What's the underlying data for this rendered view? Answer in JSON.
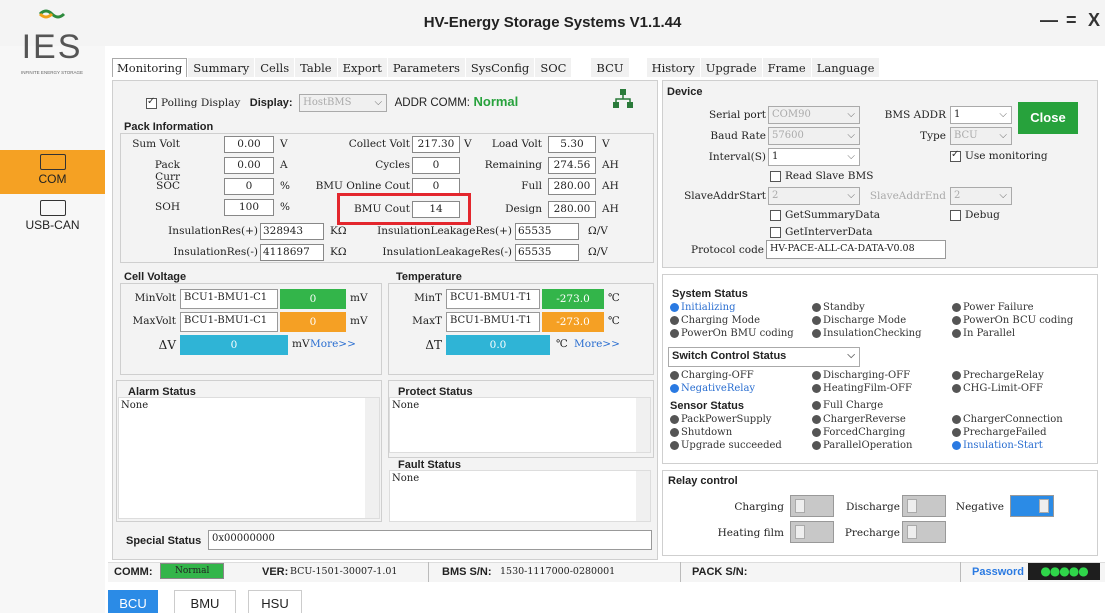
{
  "window": {
    "title": "HV-Energy Storage Systems V1.1.44",
    "min": "—",
    "restore": "=",
    "close": "X"
  },
  "sidebar": {
    "logo_text": "IES",
    "logo_sub": "INFINITE ENERGY STORAGE",
    "items": [
      {
        "label": "COM",
        "active": true
      },
      {
        "label": "USB-CAN",
        "active": false
      }
    ]
  },
  "tabs": [
    "Monitoring",
    "Summary",
    "Cells",
    "Table",
    "Export",
    "Parameters",
    "SysConfig",
    "SOC",
    "BCU",
    "History",
    "Upgrade",
    "Frame",
    "Language"
  ],
  "top": {
    "polling_label": "Polling Display",
    "display_label": "Display:",
    "display_value": "HostBMS",
    "addr_comm_label": "ADDR COMM:",
    "addr_comm_value": "Normal"
  },
  "pack": {
    "header": "Pack Information",
    "sum_volt": {
      "label": "Sum Volt",
      "value": "0.00",
      "unit": "V"
    },
    "pack_curr": {
      "label": "Pack Curr",
      "value": "0.00",
      "unit": "A"
    },
    "soc": {
      "label": "SOC",
      "value": "0",
      "unit": "%"
    },
    "soh": {
      "label": "SOH",
      "value": "100",
      "unit": "%"
    },
    "collect_volt": {
      "label": "Collect Volt",
      "value": "217.30",
      "unit": "V"
    },
    "cycles": {
      "label": "Cycles",
      "value": "0"
    },
    "bmu_online": {
      "label": "BMU Online Cout",
      "value": "0"
    },
    "bmu_cout": {
      "label": "BMU Cout",
      "value": "14"
    },
    "load_volt": {
      "label": "Load Volt",
      "value": "5.30",
      "unit": "V"
    },
    "remaining": {
      "label": "Remaining",
      "value": "274.56",
      "unit": "AH"
    },
    "full": {
      "label": "Full",
      "value": "280.00",
      "unit": "AH"
    },
    "design": {
      "label": "Design",
      "value": "280.00",
      "unit": "AH"
    },
    "ins_pos": {
      "label": "InsulationRes(+)",
      "value": "328943",
      "unit": "KΩ"
    },
    "ins_neg": {
      "label": "InsulationRes(-)",
      "value": "4118697",
      "unit": "KΩ"
    },
    "leak_pos": {
      "label": "InsulationLeakageRes(+)",
      "value": "65535",
      "unit": "Ω/V"
    },
    "leak_neg": {
      "label": "InsulationLeakageRes(-)",
      "value": "65535",
      "unit": "Ω/V"
    }
  },
  "cell_voltage": {
    "header": "Cell Voltage",
    "min_label": "MinVolt",
    "min_id": "BCU1-BMU1-C1",
    "min_val": "0",
    "max_label": "MaxVolt",
    "max_id": "BCU1-BMU1-C1",
    "max_val": "0",
    "unit": "mV",
    "delta_label": "ΔV",
    "delta_val": "0",
    "more": "More>>"
  },
  "temperature": {
    "header": "Temperature",
    "min_label": "MinT",
    "min_id": "BCU1-BMU1-T1",
    "min_val": "-273.0",
    "max_label": "MaxT",
    "max_id": "BCU1-BMU1-T1",
    "max_val": "-273.0",
    "unit": "℃",
    "delta_label": "ΔT",
    "delta_val": "0.0",
    "more": "More>>"
  },
  "alarm": {
    "header": "Alarm Status",
    "text": "None"
  },
  "protect": {
    "header": "Protect Status",
    "text": "None"
  },
  "fault": {
    "header": "Fault Status",
    "text": "None"
  },
  "special": {
    "label": "Special Status",
    "value": "0x00000000"
  },
  "device": {
    "header": "Device",
    "serial_port_label": "Serial port",
    "serial_port": "COM90",
    "bms_addr_label": "BMS ADDR",
    "bms_addr": "1",
    "close": "Close",
    "baud_label": "Baud Rate",
    "baud": "57600",
    "type_label": "Type",
    "type": "BCU",
    "interval_label": "Interval(S)",
    "interval": "1",
    "use_monitoring": "Use monitoring",
    "read_slave": "Read Slave BMS",
    "slave_start_label": "SlaveAddrStart",
    "slave_start": "2",
    "slave_end_label": "SlaveAddrEnd",
    "slave_end": "2",
    "get_summary": "GetSummaryData",
    "debug": "Debug",
    "get_interver": "GetInterverData",
    "protocol_label": "Protocol code",
    "protocol": "HV-PACE-ALL-CA-DATA-V0.08"
  },
  "system_status": {
    "header": "System Status",
    "items": [
      {
        "text": "Initializing",
        "active": true
      },
      {
        "text": "Standby",
        "active": false
      },
      {
        "text": "Power Failure",
        "active": false
      },
      {
        "text": "Charging Mode",
        "active": false
      },
      {
        "text": "Discharge Mode",
        "active": false
      },
      {
        "text": "PowerOn BCU coding",
        "active": false
      },
      {
        "text": "PowerOn BMU coding",
        "active": false
      },
      {
        "text": "InsulationChecking",
        "active": false
      },
      {
        "text": "In Parallel",
        "active": false
      }
    ],
    "switch_label": "Switch Control Status",
    "switch_items": [
      {
        "text": "Charging-OFF",
        "active": false
      },
      {
        "text": "Discharging-OFF",
        "active": false
      },
      {
        "text": "PrechargeRelay",
        "active": false
      },
      {
        "text": "NegativeRelay",
        "active": true
      },
      {
        "text": "HeatingFilm-OFF",
        "active": false
      },
      {
        "text": "CHG-Limit-OFF",
        "active": false
      }
    ],
    "sensor_label": "Sensor Status",
    "sensor_first": {
      "text": "Full Charge",
      "active": false
    },
    "sensor_items": [
      {
        "text": "PackPowerSupply",
        "active": false
      },
      {
        "text": "ChargerReverse",
        "active": false
      },
      {
        "text": "ChargerConnection",
        "active": false
      },
      {
        "text": "Shutdown",
        "active": false
      },
      {
        "text": "ForcedCharging",
        "active": false
      },
      {
        "text": "PrechargeFailed",
        "active": false
      },
      {
        "text": "Upgrade succeeded",
        "active": false
      },
      {
        "text": "ParallelOperation",
        "active": false
      },
      {
        "text": "Insulation-Start",
        "active": true
      }
    ]
  },
  "relay": {
    "header": "Relay control",
    "charging": "Charging",
    "discharge": "Discharge",
    "negative": "Negative",
    "heating": "Heating film",
    "precharge": "Precharge",
    "negative_on": true
  },
  "statusbar": {
    "comm_label": "COMM:",
    "comm_value": "Normal",
    "ver_label": "VER:",
    "ver_value": "BCU-1501-30007-1.01",
    "sn_label": "BMS S/N:",
    "sn_value": "1530-1117000-0280001",
    "pack_sn_label": "PACK S/N:",
    "password_label": "Password",
    "password_value": "●●●●●"
  },
  "bottom_tabs": [
    "BCU",
    "BMU",
    "HSU"
  ],
  "colors": {
    "green": "#33b54a",
    "orange": "#f5a024",
    "cyan": "#2fb4d6",
    "blue": "#2b8be6",
    "red": "#e3262d",
    "close_btn": "#27a23c"
  }
}
